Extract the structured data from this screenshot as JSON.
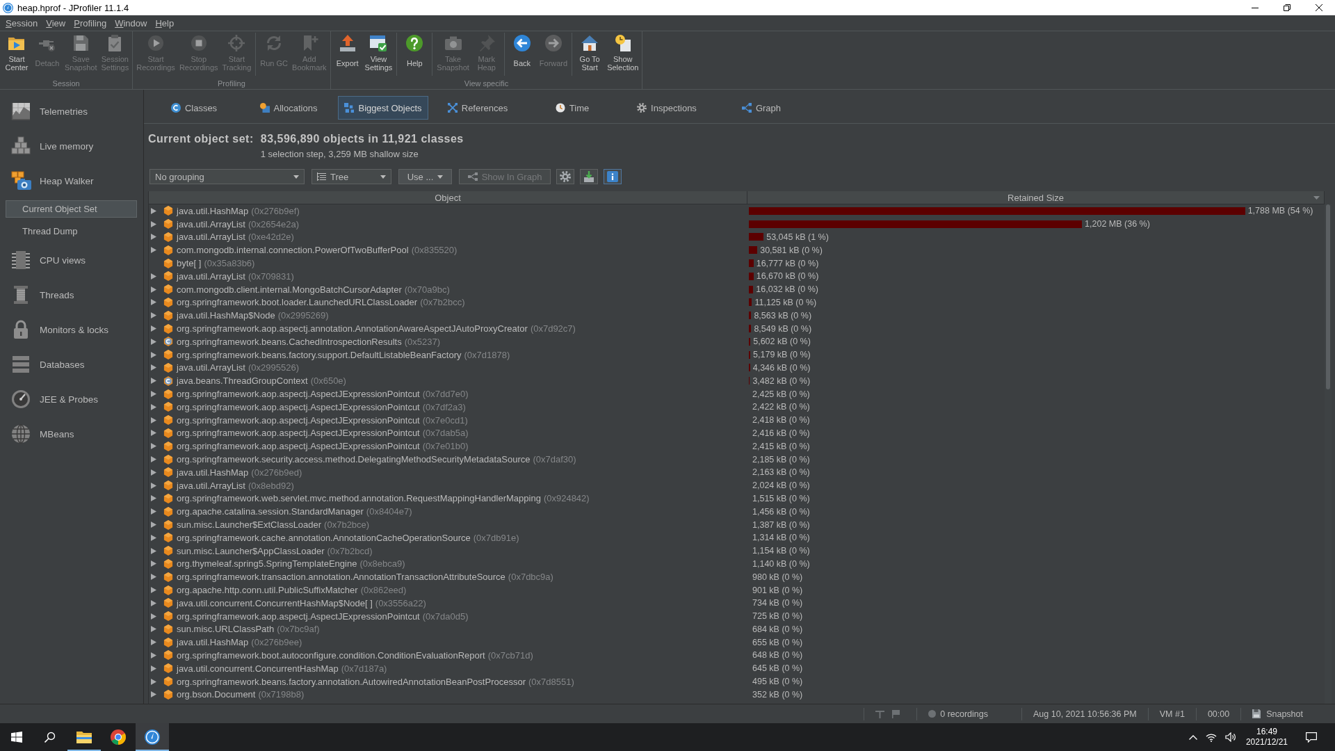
{
  "window": {
    "title": "heap.hprof - JProfiler 11.1.4"
  },
  "menu": [
    "Session",
    "View",
    "Profiling",
    "Window",
    "Help"
  ],
  "toolbar": [
    {
      "label": "Session",
      "sections": [
        [
          {
            "kind": "start_center",
            "label": "Start\nCenter",
            "disabled": false
          },
          {
            "kind": "detach",
            "label": "Detach",
            "disabled": true
          },
          {
            "kind": "save_snapshot",
            "label": "Save\nSnapshot",
            "disabled": true
          },
          {
            "kind": "session_settings",
            "label": "Session\nSettings",
            "disabled": true
          }
        ]
      ]
    },
    {
      "label": "Profiling",
      "sections": [
        [
          {
            "kind": "start_recordings",
            "label": "Start\nRecordings",
            "disabled": true
          },
          {
            "kind": "stop_recordings",
            "label": "Stop\nRecordings",
            "disabled": true
          },
          {
            "kind": "start_tracking",
            "label": "Start\nTracking",
            "disabled": true
          }
        ],
        [
          {
            "kind": "run_gc",
            "label": "Run GC",
            "disabled": true
          },
          {
            "kind": "add_bookmark",
            "label": "Add\nBookmark",
            "disabled": true
          }
        ]
      ]
    },
    {
      "label": "View specific",
      "sections": [
        [
          {
            "kind": "export",
            "label": "Export",
            "disabled": false
          },
          {
            "kind": "view_settings",
            "label": "View\nSettings",
            "disabled": false
          }
        ],
        [
          {
            "kind": "help",
            "label": "Help",
            "disabled": false
          }
        ],
        [
          {
            "kind": "take_snapshot",
            "label": "Take\nSnapshot",
            "disabled": true
          },
          {
            "kind": "mark_heap",
            "label": "Mark\nHeap",
            "disabled": true
          }
        ],
        [
          {
            "kind": "back",
            "label": "Back",
            "disabled": false
          },
          {
            "kind": "forward",
            "label": "Forward",
            "disabled": true
          }
        ],
        [
          {
            "kind": "go_to_start",
            "label": "Go To\nStart",
            "disabled": false
          },
          {
            "kind": "show_selection",
            "label": "Show\nSelection",
            "disabled": false
          }
        ]
      ]
    }
  ],
  "sidebar": {
    "items": [
      {
        "kind": "telemetries",
        "label": "Telemetries",
        "disabled": true
      },
      {
        "kind": "live_memory",
        "label": "Live memory",
        "disabled": true
      },
      {
        "kind": "heap_walker",
        "label": "Heap Walker",
        "disabled": false,
        "children": [
          {
            "label": "Current Object Set",
            "selected": true
          },
          {
            "label": "Thread Dump",
            "selected": false
          }
        ]
      },
      {
        "kind": "cpu_views",
        "label": "CPU views",
        "disabled": true
      },
      {
        "kind": "threads",
        "label": "Threads",
        "disabled": true
      },
      {
        "kind": "monitors",
        "label": "Monitors & locks",
        "disabled": true
      },
      {
        "kind": "databases",
        "label": "Databases",
        "disabled": true
      },
      {
        "kind": "jee_probes",
        "label": "JEE & Probes",
        "disabled": true
      },
      {
        "kind": "mbeans",
        "label": "MBeans",
        "disabled": true
      }
    ]
  },
  "tabs": [
    {
      "kind": "classes",
      "label": "Classes",
      "selected": false
    },
    {
      "kind": "allocations",
      "label": "Allocations",
      "selected": false
    },
    {
      "kind": "biggest_objects",
      "label": "Biggest Objects",
      "selected": true
    },
    {
      "kind": "references",
      "label": "References",
      "selected": false
    },
    {
      "kind": "time",
      "label": "Time",
      "selected": false
    },
    {
      "kind": "inspections",
      "label": "Inspections",
      "selected": false
    },
    {
      "kind": "graph",
      "label": "Graph",
      "selected": false
    }
  ],
  "object_set": {
    "label": "Current object set:",
    "summary": "83,596,890 objects in 11,921 classes",
    "detail": "1 selection step, 3,259 MB shallow size"
  },
  "view_controls": {
    "grouping": "No grouping",
    "view_mode": "Tree",
    "use_button": "Use ...",
    "show_in_graph": {
      "label": "Show In Graph",
      "disabled": true
    }
  },
  "table": {
    "columns": [
      "Object",
      "Retained Size"
    ],
    "rows": [
      {
        "kind": "object",
        "expandable": true,
        "name": "java.util.HashMap",
        "address": "(0x276b9ef)",
        "retained": "1,788 MB (54 %)",
        "level": 0.864
      },
      {
        "kind": "object",
        "expandable": true,
        "name": "java.util.ArrayList",
        "address": "(0x2654e2a)",
        "retained": "1,202 MB (36 %)",
        "level": 0.58
      },
      {
        "kind": "object",
        "expandable": true,
        "name": "java.util.ArrayList",
        "address": "(0xe42d2e)",
        "retained": "53,045 kB (1 %)",
        "level": 0.0257
      },
      {
        "kind": "object",
        "expandable": true,
        "name": "com.mongodb.internal.connection.PowerOfTwoBufferPool",
        "address": "(0x835520)",
        "retained": "30,581 kB (0 %)",
        "level": 0.0148
      },
      {
        "kind": "object",
        "expandable": false,
        "name": "byte[ ]",
        "address": "(0x35a83b6)",
        "retained": "16,777 kB (0 %)",
        "level": 0.0081
      },
      {
        "kind": "object",
        "expandable": true,
        "name": "java.util.ArrayList",
        "address": "(0x709831)",
        "retained": "16,670 kB (0 %)",
        "level": 0.0081
      },
      {
        "kind": "object",
        "expandable": true,
        "name": "com.mongodb.client.internal.MongoBatchCursorAdapter",
        "address": "(0x70a9bc)",
        "retained": "16,032 kB (0 %)",
        "level": 0.0077
      },
      {
        "kind": "object",
        "expandable": true,
        "name": "org.springframework.boot.loader.LaunchedURLClassLoader",
        "address": "(0x7b2bcc)",
        "retained": "11,125 kB (0 %)",
        "level": 0.0054
      },
      {
        "kind": "object",
        "expandable": true,
        "name": "java.util.HashMap$Node",
        "address": "(0x2995269)",
        "retained": "8,563 kB (0 %)",
        "level": 0.0041
      },
      {
        "kind": "object",
        "expandable": true,
        "name": "org.springframework.aop.aspectj.annotation.AnnotationAwareAspectJAutoProxyCreator",
        "address": "(0x7d92c7)",
        "retained": "8,549 kB (0 %)",
        "level": 0.0041
      },
      {
        "kind": "class",
        "expandable": true,
        "name": "org.springframework.beans.CachedIntrospectionResults",
        "address": "(0x5237)",
        "retained": "5,602 kB (0 %)",
        "level": 0.0027
      },
      {
        "kind": "object",
        "expandable": true,
        "name": "org.springframework.beans.factory.support.DefaultListableBeanFactory",
        "address": "(0x7d1878)",
        "retained": "5,179 kB (0 %)",
        "level": 0.0025
      },
      {
        "kind": "object",
        "expandable": true,
        "name": "java.util.ArrayList",
        "address": "(0x2995526)",
        "retained": "4,346 kB (0 %)",
        "level": 0.0021
      },
      {
        "kind": "class",
        "expandable": true,
        "name": "java.beans.ThreadGroupContext",
        "address": "(0x650e)",
        "retained": "3,482 kB (0 %)",
        "level": 0.0017
      },
      {
        "kind": "object",
        "expandable": true,
        "name": "org.springframework.aop.aspectj.AspectJExpressionPointcut",
        "address": "(0x7dd7e0)",
        "retained": "2,425 kB (0 %)"
      },
      {
        "kind": "object",
        "expandable": true,
        "name": "org.springframework.aop.aspectj.AspectJExpressionPointcut",
        "address": "(0x7df2a3)",
        "retained": "2,422 kB (0 %)"
      },
      {
        "kind": "object",
        "expandable": true,
        "name": "org.springframework.aop.aspectj.AspectJExpressionPointcut",
        "address": "(0x7e0cd1)",
        "retained": "2,418 kB (0 %)"
      },
      {
        "kind": "object",
        "expandable": true,
        "name": "org.springframework.aop.aspectj.AspectJExpressionPointcut",
        "address": "(0x7dab5a)",
        "retained": "2,416 kB (0 %)"
      },
      {
        "kind": "object",
        "expandable": true,
        "name": "org.springframework.aop.aspectj.AspectJExpressionPointcut",
        "address": "(0x7e01b0)",
        "retained": "2,415 kB (0 %)"
      },
      {
        "kind": "object",
        "expandable": true,
        "name": "org.springframework.security.access.method.DelegatingMethodSecurityMetadataSource",
        "address": "(0x7daf30)",
        "retained": "2,185 kB (0 %)"
      },
      {
        "kind": "object",
        "expandable": true,
        "name": "java.util.HashMap",
        "address": "(0x276b9ed)",
        "retained": "2,163 kB (0 %)"
      },
      {
        "kind": "object",
        "expandable": true,
        "name": "java.util.ArrayList",
        "address": "(0x8ebd92)",
        "retained": "2,024 kB (0 %)"
      },
      {
        "kind": "object",
        "expandable": true,
        "name": "org.springframework.web.servlet.mvc.method.annotation.RequestMappingHandlerMapping",
        "address": "(0x924842)",
        "retained": "1,515 kB (0 %)"
      },
      {
        "kind": "object",
        "expandable": true,
        "name": "org.apache.catalina.session.StandardManager",
        "address": "(0x8404e7)",
        "retained": "1,456 kB (0 %)"
      },
      {
        "kind": "object",
        "expandable": true,
        "name": "sun.misc.Launcher$ExtClassLoader",
        "address": "(0x7b2bce)",
        "retained": "1,387 kB (0 %)"
      },
      {
        "kind": "object",
        "expandable": true,
        "name": "org.springframework.cache.annotation.AnnotationCacheOperationSource",
        "address": "(0x7db91e)",
        "retained": "1,314 kB (0 %)"
      },
      {
        "kind": "object",
        "expandable": true,
        "name": "sun.misc.Launcher$AppClassLoader",
        "address": "(0x7b2bcd)",
        "retained": "1,154 kB (0 %)"
      },
      {
        "kind": "object",
        "expandable": true,
        "name": "org.thymeleaf.spring5.SpringTemplateEngine",
        "address": "(0x8ebca9)",
        "retained": "1,140 kB (0 %)"
      },
      {
        "kind": "object",
        "expandable": true,
        "name": "org.springframework.transaction.annotation.AnnotationTransactionAttributeSource",
        "address": "(0x7dbc9a)",
        "retained": "980 kB (0 %)"
      },
      {
        "kind": "object",
        "expandable": true,
        "name": "org.apache.http.conn.util.PublicSuffixMatcher",
        "address": "(0x862eed)",
        "retained": "901 kB (0 %)"
      },
      {
        "kind": "object",
        "expandable": true,
        "name": "java.util.concurrent.ConcurrentHashMap$Node[ ]",
        "address": "(0x3556a22)",
        "retained": "734 kB (0 %)"
      },
      {
        "kind": "object",
        "expandable": true,
        "name": "org.springframework.aop.aspectj.AspectJExpressionPointcut",
        "address": "(0x7da0d5)",
        "retained": "725 kB (0 %)"
      },
      {
        "kind": "object",
        "expandable": true,
        "name": "sun.misc.URLClassPath",
        "address": "(0x7bc9af)",
        "retained": "684 kB (0 %)"
      },
      {
        "kind": "object",
        "expandable": true,
        "name": "java.util.HashMap",
        "address": "(0x276b9ee)",
        "retained": "655 kB (0 %)"
      },
      {
        "kind": "object",
        "expandable": true,
        "name": "org.springframework.boot.autoconfigure.condition.ConditionEvaluationReport",
        "address": "(0x7cb71d)",
        "retained": "648 kB (0 %)"
      },
      {
        "kind": "object",
        "expandable": true,
        "name": "java.util.concurrent.ConcurrentHashMap",
        "address": "(0x7d187a)",
        "retained": "645 kB (0 %)"
      },
      {
        "kind": "object",
        "expandable": true,
        "name": "org.springframework.beans.factory.annotation.AutowiredAnnotationBeanPostProcessor",
        "address": "(0x7d8551)",
        "retained": "495 kB (0 %)"
      },
      {
        "kind": "object",
        "expandable": true,
        "name": "org.bson.Document",
        "address": "(0x7198b8)",
        "retained": "352 kB (0 %)"
      }
    ]
  },
  "status_bar": {
    "recordings": "0 recordings",
    "timestamp": "Aug 10, 2021 10:56:36 PM",
    "vm": "VM #1",
    "elapsed": "00:00",
    "mode": "Snapshot"
  },
  "taskbar": {
    "apps": [
      {
        "kind": "file_explorer",
        "running": true,
        "selected": false
      },
      {
        "kind": "browser",
        "running": false,
        "selected": false
      },
      {
        "kind": "profiler",
        "running": true,
        "selected": true
      }
    ],
    "time": "16:49",
    "date": "2021/12/21"
  }
}
